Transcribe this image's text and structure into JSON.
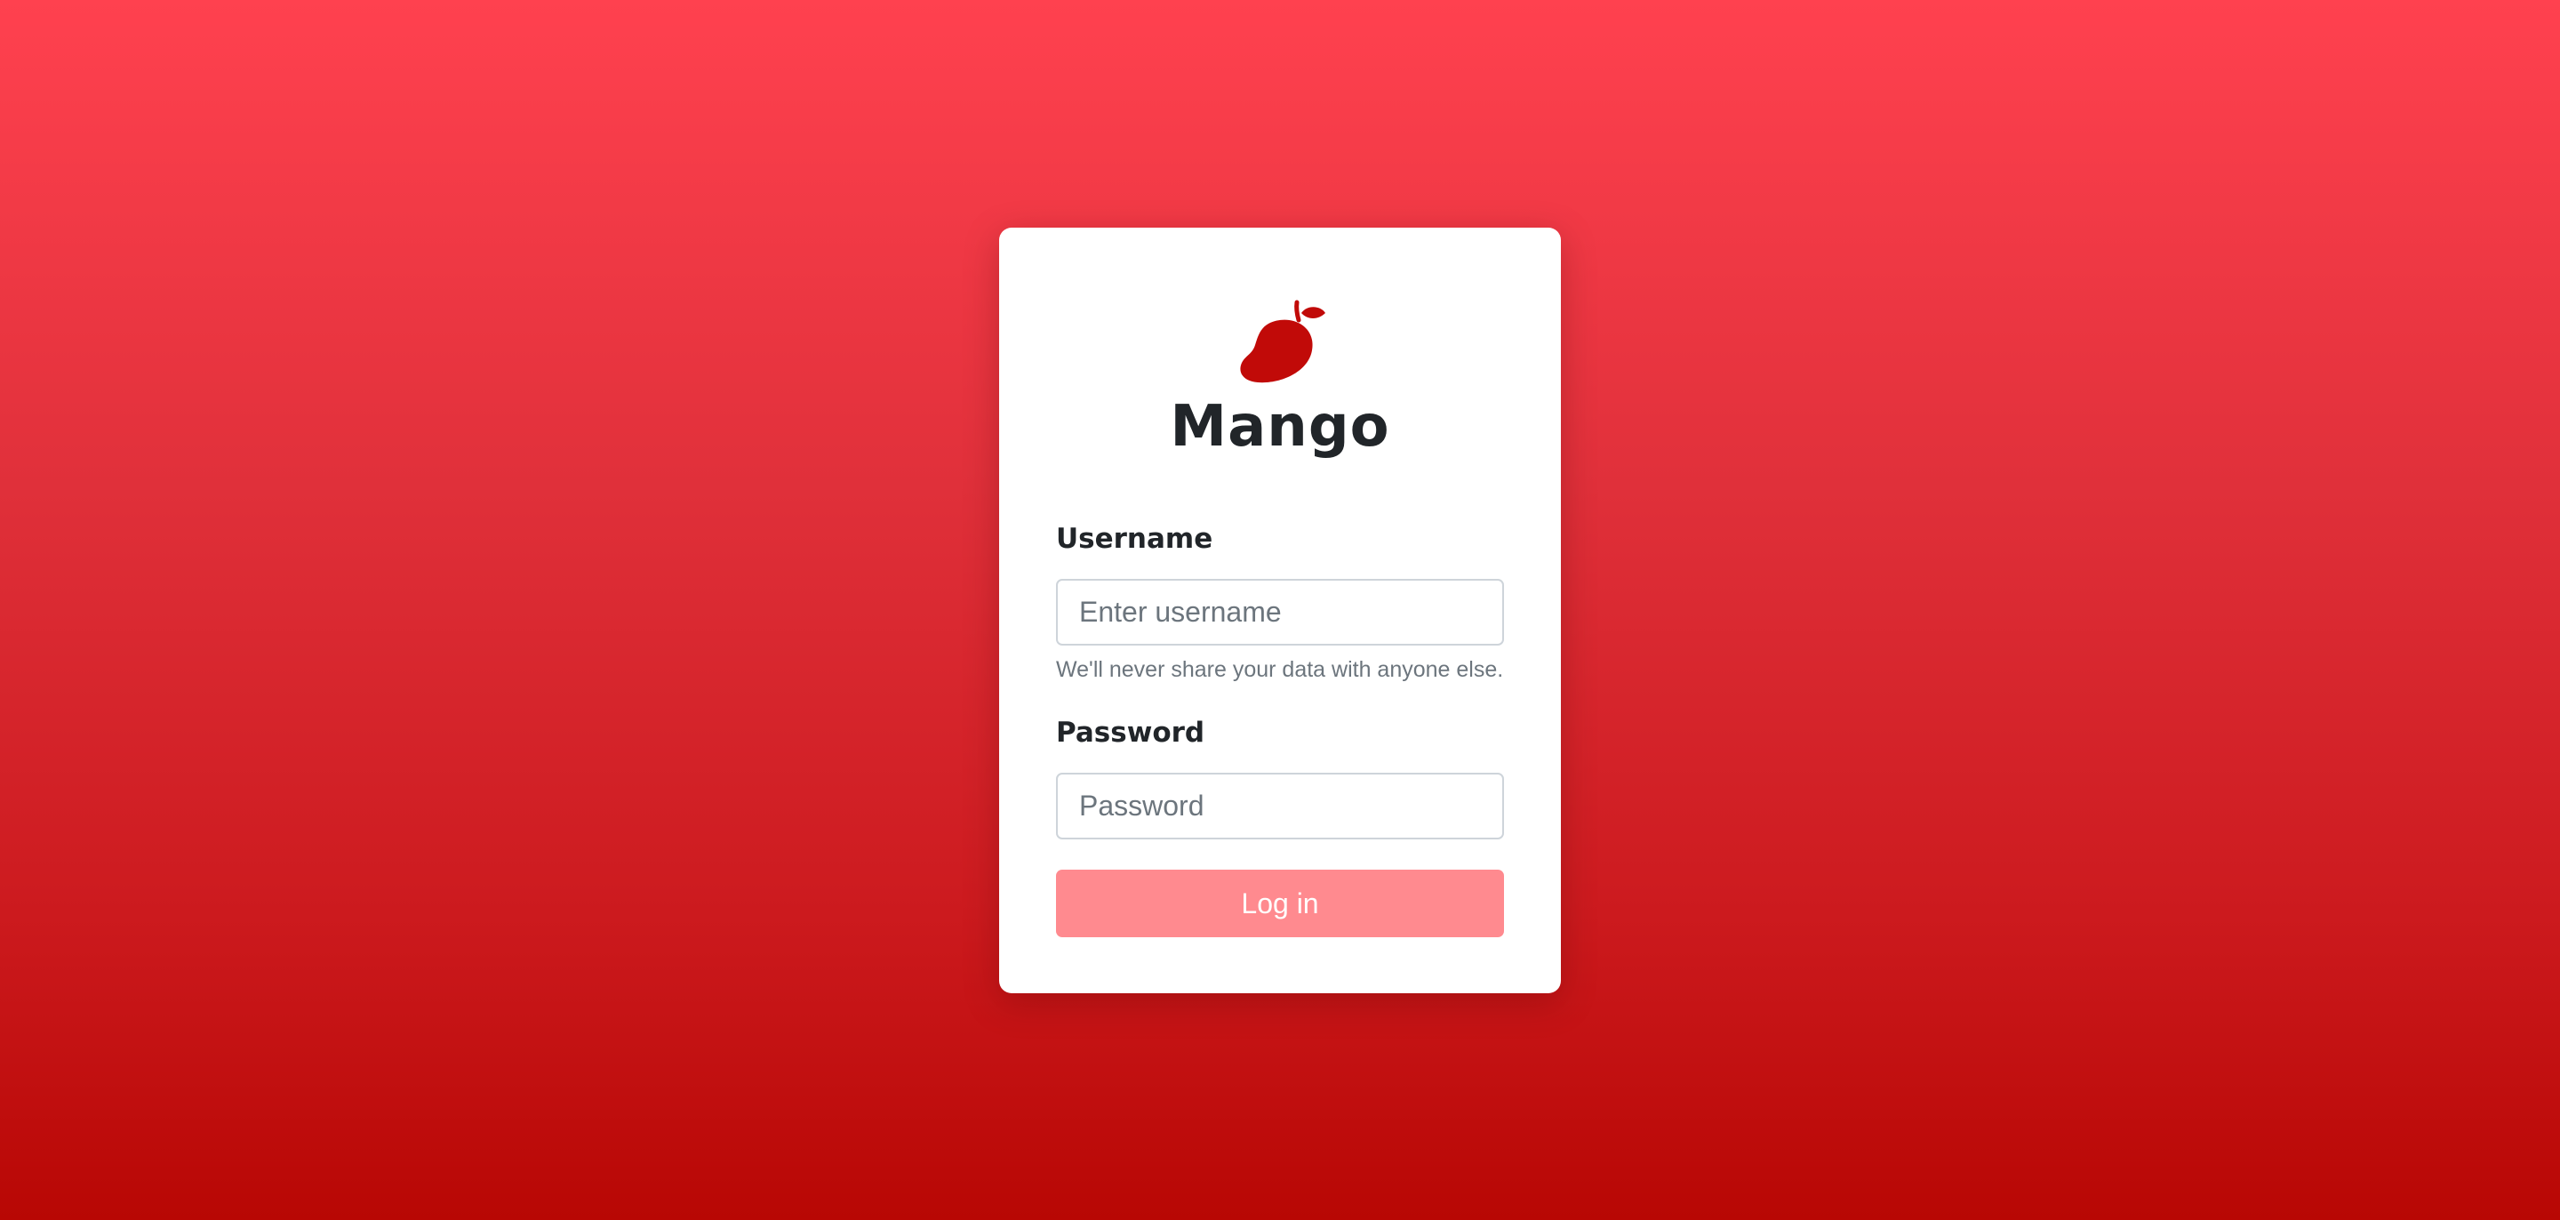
{
  "brand": {
    "name": "Mango",
    "logo_icon": "mango-icon",
    "logo_color": "#c10a08"
  },
  "form": {
    "username": {
      "label": "Username",
      "placeholder": "Enter username",
      "value": "",
      "help": "We'll never share your data with anyone else."
    },
    "password": {
      "label": "Password",
      "placeholder": "Password",
      "value": ""
    },
    "submit_label": "Log in",
    "submit_color": "#ff8a8f"
  },
  "theme": {
    "background_top": "#ff414f",
    "background_bottom": "#b80704"
  }
}
